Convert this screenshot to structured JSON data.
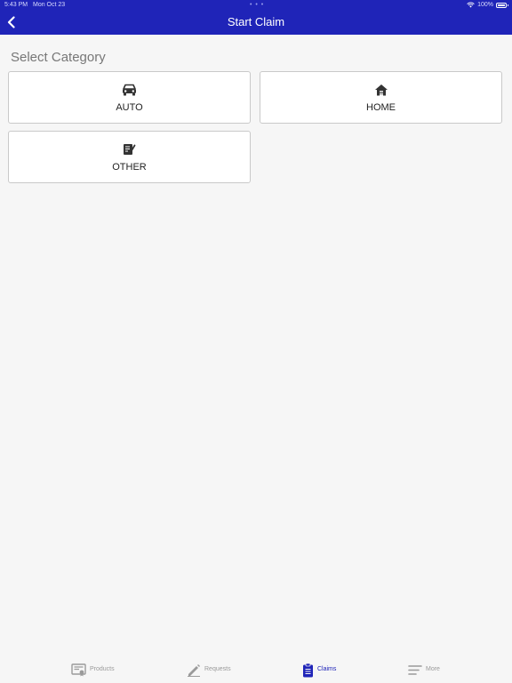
{
  "status_bar": {
    "time": "5:43 PM",
    "date": "Mon Oct 23",
    "dots": "• • •",
    "battery": "100%"
  },
  "header": {
    "title": "Start Claim",
    "back_icon": "chevron-left-icon"
  },
  "content": {
    "section_title": "Select Category",
    "categories": [
      {
        "label": "AUTO",
        "icon": "car-icon"
      },
      {
        "label": "HOME",
        "icon": "house-icon"
      },
      {
        "label": "OTHER",
        "icon": "document-edit-icon"
      }
    ]
  },
  "tabbar": {
    "active": "Claims",
    "items": [
      {
        "label": "Products",
        "icon": "certificate-icon"
      },
      {
        "label": "Requests",
        "icon": "pencil-icon"
      },
      {
        "label": "Claims",
        "icon": "clipboard-icon"
      },
      {
        "label": "More",
        "icon": "menu-lines-icon"
      }
    ]
  },
  "colors": {
    "primary": "#1f24b8",
    "background": "#f6f6f6",
    "card": "#ffffff",
    "inactive": "#9a9a9a"
  }
}
